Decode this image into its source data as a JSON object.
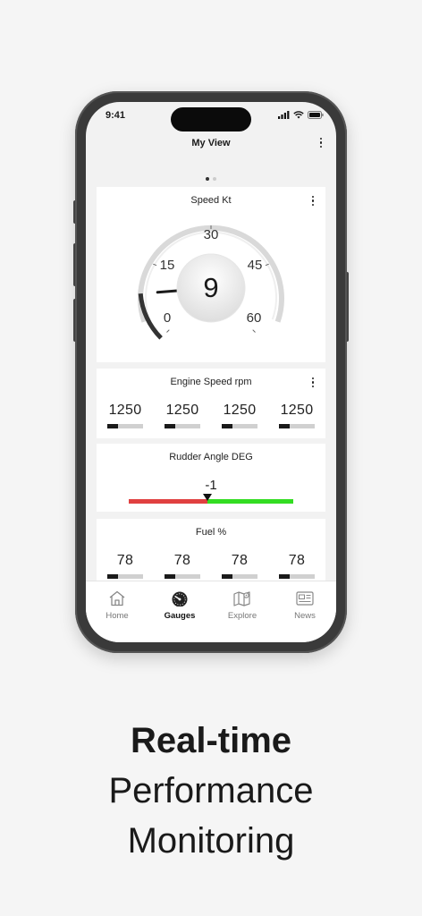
{
  "status": {
    "time": "9:41"
  },
  "header": {
    "title": "My View"
  },
  "pager": {
    "pages": 2,
    "active": 0
  },
  "speed": {
    "title": "Speed  Kt",
    "value": "9",
    "ticks": [
      "0",
      "15",
      "30",
      "45",
      "60"
    ],
    "min": 0,
    "max": 60,
    "current": 9
  },
  "engine": {
    "title": "Engine Speed  rpm",
    "values": [
      "1250",
      "1250",
      "1250",
      "1250"
    ],
    "level": 0.3
  },
  "rudder": {
    "title": "Rudder Angle  DEG",
    "value": "-1",
    "port_color": "#e04040",
    "starboard_color": "#33dd22"
  },
  "fuel": {
    "title": "Fuel  %",
    "values": [
      "78",
      "78",
      "78",
      "78"
    ],
    "level": 0.3
  },
  "tabs": [
    {
      "label": "Home",
      "icon": "home-icon"
    },
    {
      "label": "Gauges",
      "icon": "gauge-icon"
    },
    {
      "label": "Explore",
      "icon": "map-icon"
    },
    {
      "label": "News",
      "icon": "news-icon"
    }
  ],
  "tagline": {
    "line1": "Real-time",
    "line2": "Performance",
    "line3": "Monitoring"
  }
}
